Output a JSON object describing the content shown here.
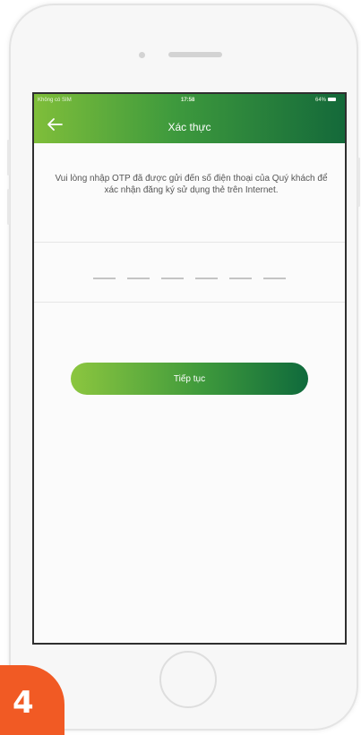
{
  "status_bar": {
    "carrier": "Không có SIM",
    "time": "17:58",
    "battery": "64%"
  },
  "header": {
    "back_icon": "arrow-left-icon",
    "title": "Xác thực"
  },
  "content": {
    "message": "Vui lòng nhập OTP đã được gửi đến số điện thoại của Quý khách để xác nhận đăng ký sử dụng thẻ trên Internet.",
    "otp_slots": 6
  },
  "button": {
    "label": "Tiếp tục"
  },
  "step": {
    "number": "4"
  },
  "colors": {
    "gradient_start": "#8cc63f",
    "gradient_end": "#0f6a3c",
    "badge": "#f15a24"
  }
}
